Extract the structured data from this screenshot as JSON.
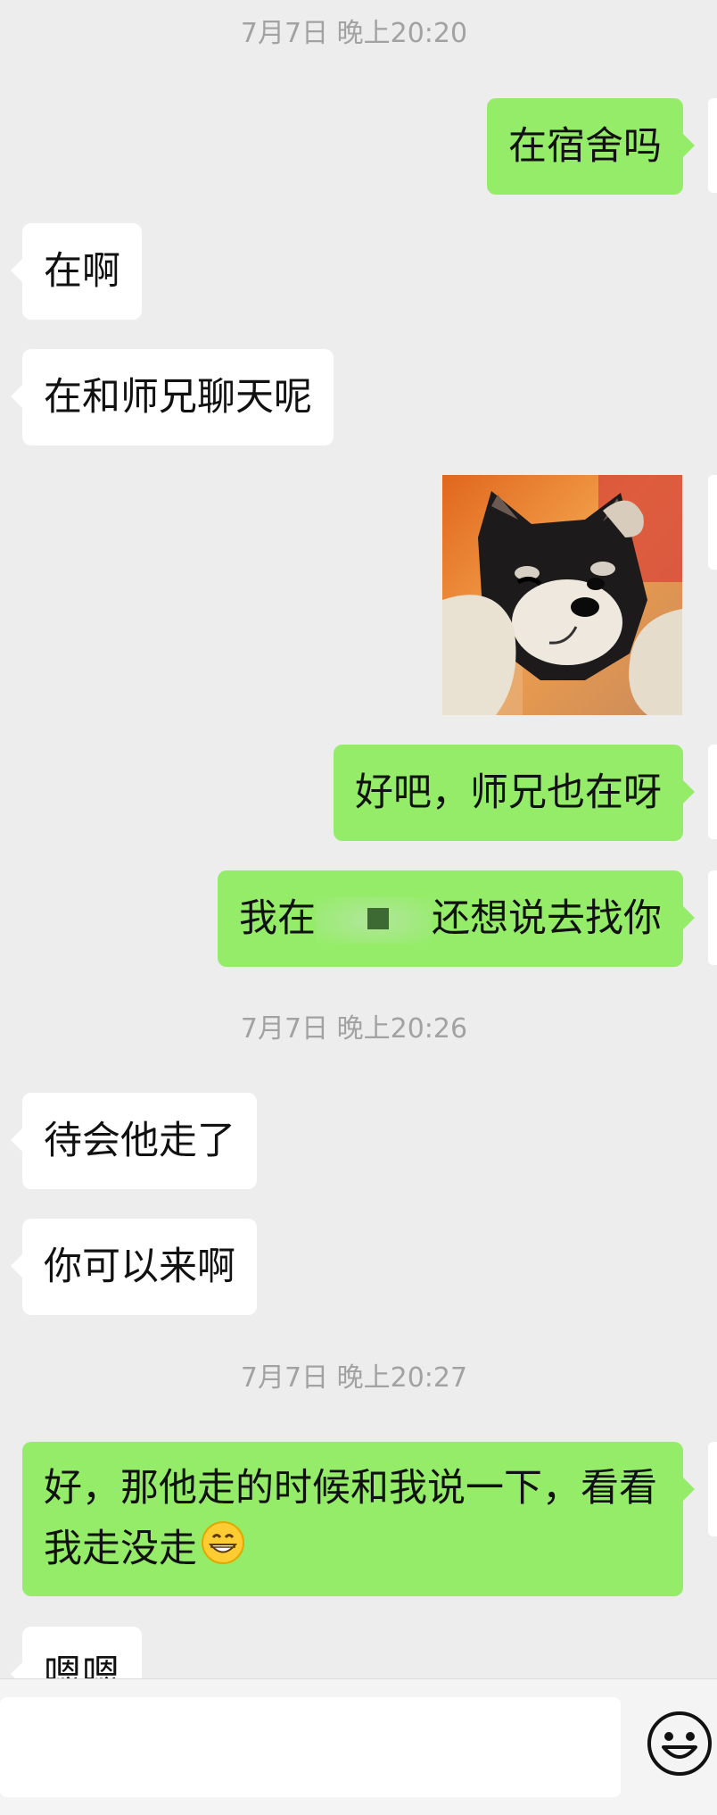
{
  "timestamps": [
    "7月7日 晚上20:20",
    "7月7日 晚上20:26",
    "7月7日 晚上20:27"
  ],
  "messages": {
    "m1": "在宿舍吗",
    "m2": "在啊",
    "m3": "在和师兄聊天呢",
    "m4": "好吧，师兄也在呀",
    "m5a": "我在",
    "m5b": "还想说去找你",
    "m6": "待会他走了",
    "m7": "你可以来啊",
    "m8_line1": "好，那他走的时候和我说一下，看看",
    "m8_line2": "我走没走",
    "m9": "嗯嗯"
  },
  "sticker": {
    "description_icon": "shiba-dog-sticker"
  },
  "input": {
    "placeholder": ""
  },
  "colors": {
    "bg": "#ededed",
    "sent": "#95ec69",
    "received": "#ffffff",
    "timestamp": "#a2a2a2"
  }
}
